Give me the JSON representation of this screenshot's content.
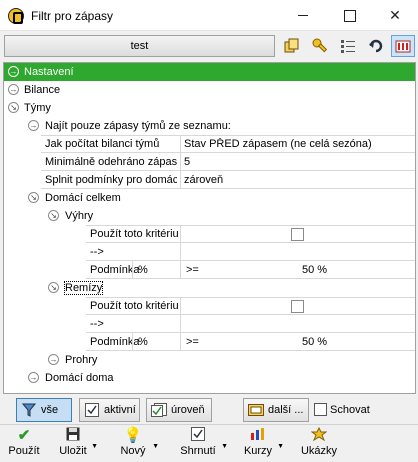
{
  "window": {
    "title": "Filtr pro zápasy"
  },
  "toolbar": {
    "profile_label": "test",
    "icons": [
      "copy-icon",
      "key-icon",
      "list-settings-icon",
      "undo-icon",
      "bar-chart-icon"
    ]
  },
  "tree": {
    "nastaveni": "Nastavení",
    "bilance": "Bilance",
    "tymy": "Týmy",
    "najit_pouze": "Najít pouze zápasy týmů ze seznamu:",
    "jak_pocitat_label": "Jak počítat bilanci týmů",
    "jak_pocitat_value": "Stav PŘED zápasem (ne celá sezóna)",
    "min_odehrano_label": "Minimálně odehráno zápasů",
    "min_odehrano_value": "5",
    "splnit_label": "Splnit podmínky pro domácí",
    "splnit_value": "zároveň",
    "domaci_celkem": "Domácí celkem",
    "vyhry": "Výhry",
    "remizy": "Remízy",
    "prohry": "Prohry",
    "domaci_doma": "Domácí doma",
    "pouzit_kriterium": "Použít toto kritérium",
    "arrow": "-->",
    "podminka": "Podmínka",
    "percent": "%",
    "operator": ">=",
    "vyhry_value": "50 %",
    "remizy_value": "50 %"
  },
  "bottom": {
    "vse": "vše",
    "aktivni": "aktivní",
    "uroven": "úroveň",
    "dalsi": "další ...",
    "schovat": "Schovat"
  },
  "footer": {
    "pouzit": "Použít",
    "ulozit": "Uložit",
    "novy": "Nový",
    "shrnuti": "Shrnutí",
    "kurzy": "Kurzy",
    "ukazky": "Ukázky"
  }
}
